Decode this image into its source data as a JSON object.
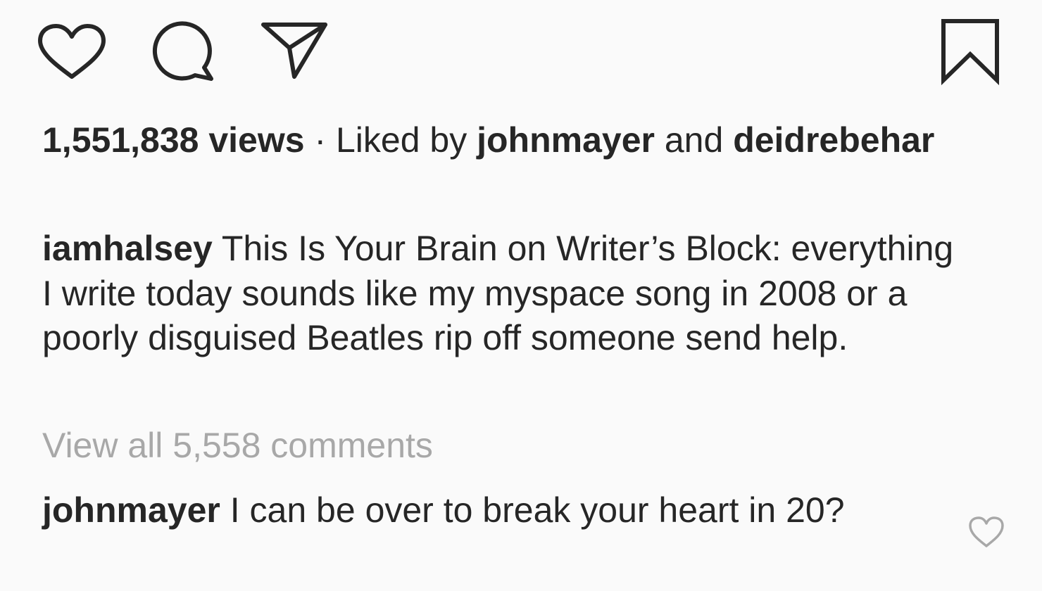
{
  "actions": {
    "like_icon": "heart-icon",
    "comment_icon": "comment-bubble-icon",
    "share_icon": "paper-plane-icon",
    "save_icon": "bookmark-icon"
  },
  "stats": {
    "views": "1,551,838 views",
    "separator": " · ",
    "liked_by_prefix": "Liked by ",
    "liked_user_1": "johnmayer",
    "and_text": " and ",
    "liked_user_2": "deidrebehar"
  },
  "caption": {
    "username": "iamhalsey",
    "text": "This Is Your Brain on Writer’s Block: everything I write today sounds like my myspace song in 2008 or a poorly disguised Beatles rip off someone send help."
  },
  "comments": {
    "view_all_label": "View all 5,558 comments",
    "items": [
      {
        "username": "johnmayer",
        "text": "I can be over to break your heart in 20?",
        "like_icon": "heart-outline-icon"
      }
    ]
  },
  "colors": {
    "text": "#262626",
    "muted": "#a8a8a8",
    "background": "#fafafa"
  }
}
